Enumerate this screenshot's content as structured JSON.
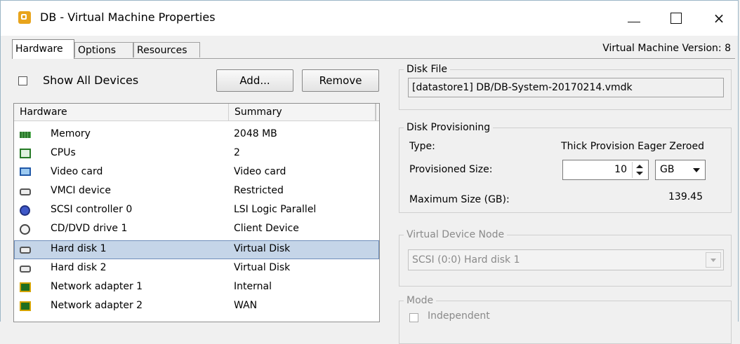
{
  "window": {
    "title": "DB - Virtual Machine Properties",
    "controls": {
      "minimize": "minimize",
      "maximize": "maximize",
      "close": "×"
    }
  },
  "tabs": [
    {
      "label": "Hardware",
      "active": true
    },
    {
      "label": "Options",
      "active": false
    },
    {
      "label": "Resources",
      "active": false
    }
  ],
  "version_label": "Virtual Machine Version: 8",
  "show_all_devices": {
    "label": "Show All Devices",
    "checked": false
  },
  "buttons": {
    "add": "Add...",
    "remove": "Remove"
  },
  "hardware_table": {
    "columns": [
      "Hardware",
      "Summary"
    ],
    "rows": [
      {
        "icon": "memory-icon",
        "name": "Memory",
        "summary": "2048 MB",
        "selected": false
      },
      {
        "icon": "cpu-icon",
        "name": "CPUs",
        "summary": "2",
        "selected": false
      },
      {
        "icon": "video-card-icon",
        "name": "Video card",
        "summary": "Video card",
        "selected": false
      },
      {
        "icon": "vmci-device-icon",
        "name": "VMCI device",
        "summary": "Restricted",
        "selected": false
      },
      {
        "icon": "scsi-controller-icon",
        "name": "SCSI controller 0",
        "summary": "LSI Logic Parallel",
        "selected": false
      },
      {
        "icon": "cd-dvd-icon",
        "name": "CD/DVD drive 1",
        "summary": "Client Device",
        "selected": false
      },
      {
        "icon": "hard-disk-icon",
        "name": "Hard disk 1",
        "summary": "Virtual Disk",
        "selected": true
      },
      {
        "icon": "hard-disk-icon",
        "name": "Hard disk 2",
        "summary": "Virtual Disk",
        "selected": false
      },
      {
        "icon": "network-adapter-icon",
        "name": "Network adapter 1",
        "summary": "Internal",
        "selected": false
      },
      {
        "icon": "network-adapter-icon",
        "name": "Network adapter 2",
        "summary": "WAN",
        "selected": false
      }
    ]
  },
  "disk_file": {
    "legend": "Disk File",
    "value": "[datastore1] DB/DB-System-20170214.vmdk"
  },
  "disk_provisioning": {
    "legend": "Disk Provisioning",
    "type_label": "Type:",
    "type_value": "Thick Provision Eager Zeroed",
    "provisioned_label": "Provisioned Size:",
    "provisioned_value": "10",
    "unit": "GB",
    "max_label": "Maximum Size (GB):",
    "max_value": "139.45"
  },
  "virtual_device_node": {
    "legend": "Virtual Device Node",
    "value": "SCSI (0:0) Hard disk 1"
  },
  "mode": {
    "legend": "Mode",
    "independent_label": "Independent"
  },
  "colors": {
    "selection": "#c5d5e8",
    "selection_border": "#6f8ebb",
    "window_bg": "#f0f0f0",
    "disabled_text": "#8a8a8a"
  }
}
